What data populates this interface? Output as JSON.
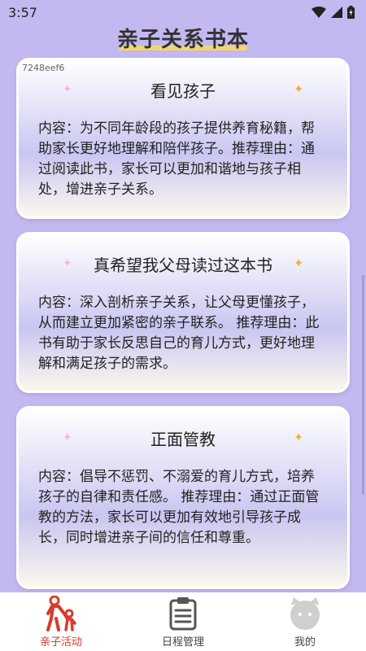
{
  "status_bar": {
    "time": "3:57"
  },
  "page": {
    "title": "亲子关系书本"
  },
  "cards": [
    {
      "id": "7248eef6",
      "title": "看见孩子",
      "body": "内容：为不同年龄段的孩子提供养育秘籍，帮助家长更好地理解和陪伴孩子。推荐理由：通过阅读此书，家长可以更加和谐地与孩子相处，增进亲子关系。"
    },
    {
      "title": "真希望我父母读过这本书",
      "body": "内容：深入剖析亲子关系，让父母更懂孩子，从而建立更加紧密的亲子联系。 推荐理由：此书有助于家长反思自己的育儿方式，更好地理解和满足孩子的需求。"
    },
    {
      "title": "正面管教",
      "body": "内容：倡导不惩罚、不溺爱的育儿方式，培养孩子的自律和责任感。 推荐理由：通过正面管教的方法，家长可以更加有效地引导孩子成长，同时增进亲子间的信任和尊重。"
    }
  ],
  "bottom_nav": {
    "items": [
      {
        "label": "亲子活动",
        "icon": "parent-child-icon",
        "active": true
      },
      {
        "label": "日程管理",
        "icon": "clipboard-icon",
        "active": false
      },
      {
        "label": "我的",
        "icon": "profile-face-icon",
        "active": false
      }
    ]
  },
  "colors": {
    "background": "#c3b8f0",
    "title_underline": "#f5d56a",
    "active_nav": "#d93a2a",
    "sparkle_left": "#f2b6e0",
    "sparkle_right": "#f4a93c"
  }
}
